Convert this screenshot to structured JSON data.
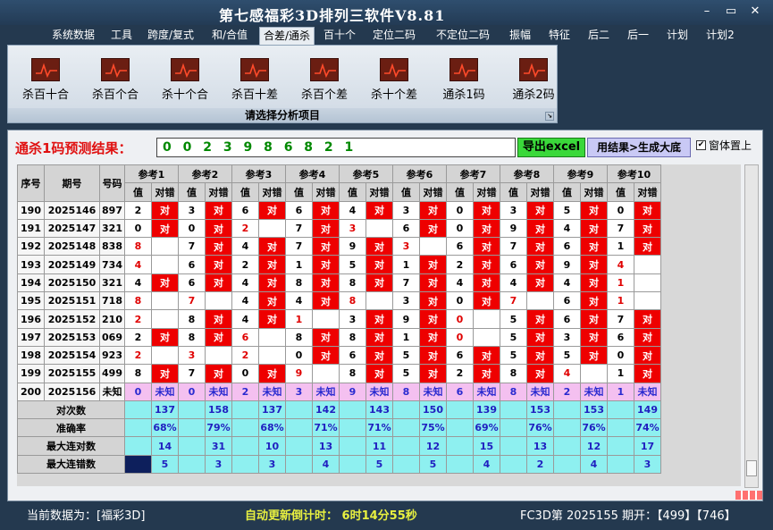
{
  "window": {
    "title": "第七感福彩3D排列三软件V8.81",
    "min": "–",
    "max": "▭",
    "close": "✕"
  },
  "menu": [
    "系统数据",
    "工具",
    "跨度/复式",
    "和/合值",
    "合差/通杀",
    "百十个",
    "定位二码",
    "不定位二码",
    "振幅",
    "特征",
    "后二",
    "后一",
    "计划",
    "计划2"
  ],
  "menu_active": 4,
  "ribbon": {
    "buttons": [
      "杀百十合",
      "杀百个合",
      "杀十个合",
      "杀百十差",
      "杀百个差",
      "杀十个差",
      "通杀1码",
      "通杀2码"
    ],
    "footer": "请选择分析项目",
    "corner": "↘"
  },
  "prediction": {
    "label": "通杀1码预测结果：",
    "value": "0 0 2 3 9 8 6 8 2 1",
    "export_button": "导出excel",
    "apply_button": "用结果>生成大底",
    "ontop_label": "窗体置上",
    "ontop_checked": "✔"
  },
  "grid": {
    "headers": {
      "seq": "序号",
      "issue": "期号",
      "code": "号码",
      "value": "值",
      "hit": "对错",
      "refs": [
        "参考1",
        "参考2",
        "参考3",
        "参考4",
        "参考5",
        "参考6",
        "参考7",
        "参考8",
        "参考9",
        "参考10"
      ]
    },
    "hit_text": "对",
    "rows": [
      {
        "seq": "190",
        "issue": "2025146",
        "code": "897",
        "vals": [
          "2",
          "3",
          "6",
          "6",
          "4",
          "3",
          "0",
          "3",
          "5",
          "0"
        ],
        "hits": [
          1,
          1,
          1,
          1,
          1,
          1,
          1,
          1,
          1,
          1
        ],
        "red": [
          0,
          0,
          0,
          0,
          0,
          0,
          0,
          0,
          0,
          0
        ]
      },
      {
        "seq": "191",
        "issue": "2025147",
        "code": "321",
        "vals": [
          "0",
          "0",
          "2",
          "7",
          "3",
          "6",
          "0",
          "9",
          "4",
          "7"
        ],
        "hits": [
          1,
          1,
          0,
          1,
          0,
          1,
          1,
          1,
          1,
          1
        ],
        "red": [
          0,
          0,
          1,
          0,
          1,
          0,
          0,
          0,
          0,
          0
        ]
      },
      {
        "seq": "192",
        "issue": "2025148",
        "code": "838",
        "vals": [
          "8",
          "7",
          "4",
          "7",
          "9",
          "3",
          "6",
          "7",
          "6",
          "1"
        ],
        "hits": [
          0,
          1,
          1,
          1,
          1,
          0,
          1,
          1,
          1,
          1
        ],
        "red": [
          1,
          0,
          0,
          0,
          0,
          1,
          0,
          0,
          0,
          0
        ]
      },
      {
        "seq": "193",
        "issue": "2025149",
        "code": "734",
        "vals": [
          "4",
          "6",
          "2",
          "1",
          "5",
          "1",
          "2",
          "6",
          "9",
          "4"
        ],
        "hits": [
          0,
          1,
          1,
          1,
          1,
          1,
          1,
          1,
          1,
          0
        ],
        "red": [
          1,
          0,
          0,
          0,
          0,
          0,
          0,
          0,
          0,
          1
        ]
      },
      {
        "seq": "194",
        "issue": "2025150",
        "code": "321",
        "vals": [
          "4",
          "6",
          "4",
          "8",
          "8",
          "7",
          "4",
          "4",
          "4",
          "1"
        ],
        "hits": [
          1,
          1,
          1,
          1,
          1,
          1,
          1,
          1,
          1,
          0
        ],
        "red": [
          0,
          0,
          0,
          0,
          0,
          0,
          0,
          0,
          0,
          1
        ]
      },
      {
        "seq": "195",
        "issue": "2025151",
        "code": "718",
        "vals": [
          "8",
          "7",
          "4",
          "4",
          "8",
          "3",
          "0",
          "7",
          "6",
          "1"
        ],
        "hits": [
          0,
          0,
          1,
          1,
          0,
          1,
          1,
          0,
          1,
          0
        ],
        "red": [
          1,
          1,
          0,
          0,
          1,
          0,
          0,
          1,
          0,
          1
        ]
      },
      {
        "seq": "196",
        "issue": "2025152",
        "code": "210",
        "vals": [
          "2",
          "8",
          "4",
          "1",
          "3",
          "9",
          "0",
          "5",
          "6",
          "7"
        ],
        "hits": [
          0,
          1,
          1,
          0,
          1,
          1,
          0,
          1,
          1,
          1
        ],
        "red": [
          1,
          0,
          0,
          1,
          0,
          0,
          1,
          0,
          0,
          0
        ]
      },
      {
        "seq": "197",
        "issue": "2025153",
        "code": "069",
        "vals": [
          "2",
          "8",
          "6",
          "8",
          "8",
          "1",
          "0",
          "5",
          "3",
          "6"
        ],
        "hits": [
          1,
          1,
          0,
          1,
          1,
          1,
          0,
          1,
          1,
          1
        ],
        "red": [
          0,
          0,
          1,
          0,
          0,
          0,
          1,
          0,
          0,
          0
        ]
      },
      {
        "seq": "198",
        "issue": "2025154",
        "code": "923",
        "vals": [
          "2",
          "3",
          "2",
          "0",
          "6",
          "5",
          "6",
          "5",
          "5",
          "0"
        ],
        "hits": [
          0,
          0,
          0,
          1,
          1,
          1,
          1,
          1,
          1,
          1
        ],
        "red": [
          1,
          1,
          1,
          0,
          0,
          0,
          0,
          0,
          0,
          0
        ]
      },
      {
        "seq": "199",
        "issue": "2025155",
        "code": "499",
        "vals": [
          "8",
          "7",
          "0",
          "9",
          "8",
          "5",
          "2",
          "8",
          "4",
          "1"
        ],
        "hits": [
          1,
          1,
          1,
          0,
          1,
          1,
          1,
          1,
          0,
          1
        ],
        "red": [
          0,
          0,
          0,
          1,
          0,
          0,
          0,
          0,
          1,
          0
        ]
      }
    ],
    "unknown_row": {
      "seq": "200",
      "issue": "2025156",
      "code": "未知",
      "vals": [
        "0",
        "0",
        "2",
        "3",
        "9",
        "8",
        "6",
        "8",
        "2",
        "1"
      ],
      "hit": "未知"
    },
    "stats": [
      {
        "label": "对次数",
        "vals": [
          "137",
          "158",
          "137",
          "142",
          "143",
          "150",
          "139",
          "153",
          "153",
          "149"
        ]
      },
      {
        "label": "准确率",
        "vals": [
          "68%",
          "79%",
          "68%",
          "71%",
          "71%",
          "75%",
          "69%",
          "76%",
          "76%",
          "74%"
        ]
      },
      {
        "label": "最大连对数",
        "vals": [
          "14",
          "31",
          "10",
          "13",
          "11",
          "12",
          "15",
          "13",
          "12",
          "17"
        ]
      },
      {
        "label": "最大连错数",
        "vals": [
          "5",
          "3",
          "3",
          "4",
          "5",
          "5",
          "4",
          "2",
          "4",
          "3"
        ]
      }
    ]
  },
  "status": {
    "current_data": "当前数据为：[福彩3D]",
    "countdown": "自动更新倒计时：  6时14分55秒",
    "issue_info": "FC3D第 2025155 期开：【499】【746】"
  }
}
